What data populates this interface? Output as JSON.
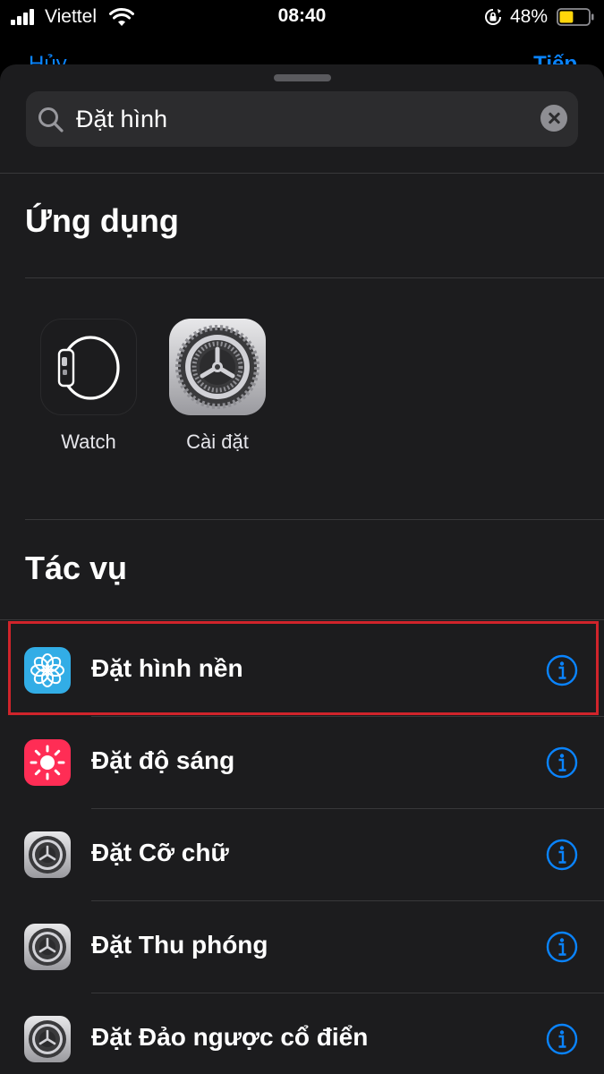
{
  "status_bar": {
    "carrier": "Viettel",
    "time": "08:40",
    "battery_percent": "48%",
    "battery_level": 0.48,
    "battery_color": "#ffd60a"
  },
  "background_nav": {
    "left_label": "Hủy",
    "right_label": "Tiếp"
  },
  "search": {
    "value": "Đặt hình",
    "icon": "search-icon"
  },
  "apps_section": {
    "title": "Ứng dụng",
    "apps": [
      {
        "label": "Watch",
        "icon": "watch-icon"
      },
      {
        "label": "Cài đặt",
        "icon": "settings-gear-icon"
      }
    ]
  },
  "actions_section": {
    "title": "Tác vụ",
    "items": [
      {
        "label": "Đặt hình nền",
        "icon": "wallpaper-icon",
        "icon_color": "#32ade6",
        "highlighted": true
      },
      {
        "label": "Đặt độ sáng",
        "icon": "brightness-icon",
        "icon_color": "#ff2d55"
      },
      {
        "label": "Đặt Cỡ chữ",
        "icon": "settings-gear-icon"
      },
      {
        "label": "Đặt Thu phóng",
        "icon": "settings-gear-icon"
      },
      {
        "label": "Đặt Đảo ngược cổ điển",
        "icon": "settings-gear-icon"
      }
    ]
  },
  "colors": {
    "accent": "#0a84ff",
    "highlight_border": "#d0242b",
    "sheet_background": "#1c1c1e"
  }
}
